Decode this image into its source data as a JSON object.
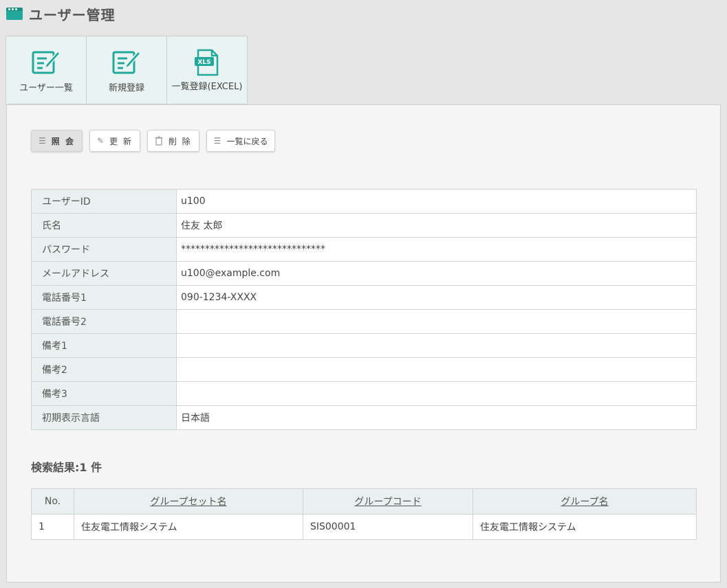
{
  "header": {
    "title": "ユーザー管理",
    "icon": "window-icon"
  },
  "tabs": [
    {
      "label": "ユーザー一覧",
      "icon": "edit-list-icon"
    },
    {
      "label": "新規登録",
      "icon": "edit-form-icon"
    },
    {
      "label": "一覧登録(EXCEL)",
      "icon": "xls-file-icon",
      "icon_text": "XLS"
    }
  ],
  "toolbar": {
    "view_label": "照 会",
    "update_label": "更 新",
    "delete_label": "削 除",
    "back_label": "一覧に戻る"
  },
  "detail": {
    "rows": [
      {
        "label": "ユーザーID",
        "value": "u100"
      },
      {
        "label": "氏名",
        "value": "住友 太郎"
      },
      {
        "label": "パスワード",
        "value": "******************************"
      },
      {
        "label": "メールアドレス",
        "value": "u100@example.com"
      },
      {
        "label": "電話番号1",
        "value": "090-1234-XXXX"
      },
      {
        "label": "電話番号2",
        "value": ""
      },
      {
        "label": "備考1",
        "value": ""
      },
      {
        "label": "備考2",
        "value": ""
      },
      {
        "label": "備考3",
        "value": ""
      },
      {
        "label": "初期表示言語",
        "value": "日本語"
      }
    ]
  },
  "results": {
    "title": "検索結果:1 件",
    "columns": [
      "No.",
      "グループセット名",
      "グループコード",
      "グループ名"
    ],
    "rows": [
      [
        "1",
        "住友電工情報システム",
        "SIS00001",
        "住友電工情報システム"
      ]
    ]
  },
  "colors": {
    "accent": "#23a99b",
    "label_bg": "#e9f1f0"
  }
}
